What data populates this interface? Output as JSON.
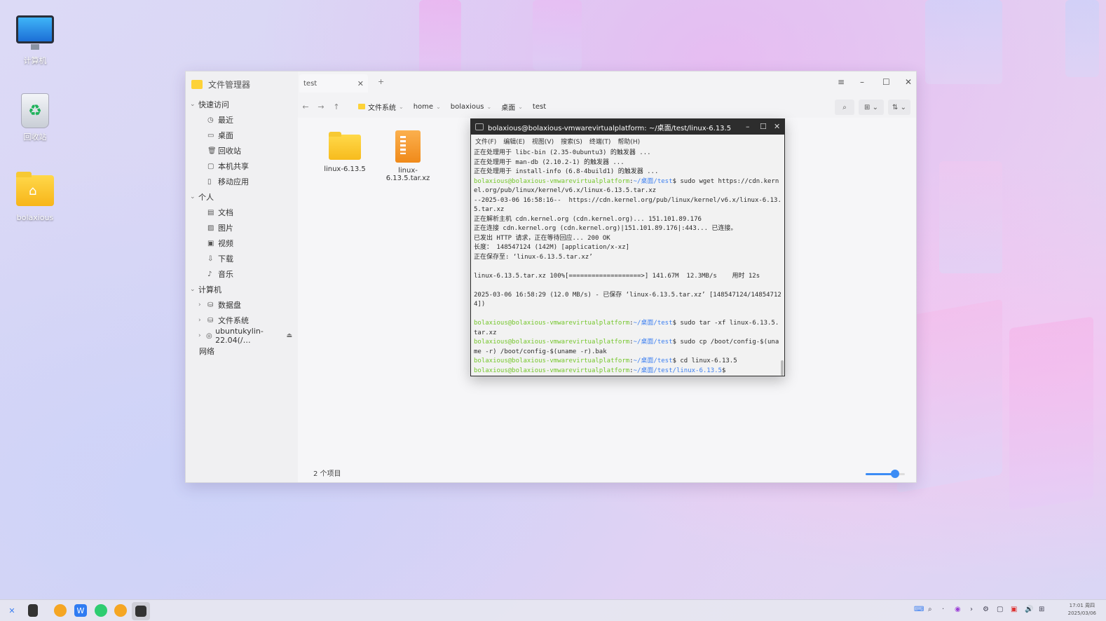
{
  "desktop": {
    "icons": [
      {
        "label": "计算机"
      },
      {
        "label": "回收站"
      },
      {
        "label": "bolaxious"
      }
    ]
  },
  "file_manager": {
    "app_title": "文件管理器",
    "tab_label": "test",
    "tab_close": "✕",
    "tab_add": "+",
    "window_controls": {
      "menu": "≡",
      "minimize": "–",
      "maximize": "☐",
      "close": "✕"
    },
    "sidebar": {
      "groups": [
        {
          "label": "快速访问",
          "items": [
            {
              "label": "最近",
              "icon": "clock-icon"
            },
            {
              "label": "桌面",
              "icon": "desktop-icon"
            },
            {
              "label": "回收站",
              "icon": "trash-icon"
            },
            {
              "label": "本机共享",
              "icon": "share-icon"
            },
            {
              "label": "移动应用",
              "icon": "phone-icon"
            }
          ]
        },
        {
          "label": "个人",
          "items": [
            {
              "label": "文档",
              "icon": "document-icon"
            },
            {
              "label": "图片",
              "icon": "image-icon"
            },
            {
              "label": "视频",
              "icon": "video-icon"
            },
            {
              "label": "下载",
              "icon": "download-icon"
            },
            {
              "label": "音乐",
              "icon": "music-icon"
            }
          ]
        },
        {
          "label": "计算机",
          "items": [
            {
              "label": "数据盘",
              "icon": "drive-icon"
            },
            {
              "label": "文件系统",
              "icon": "drive-icon"
            },
            {
              "label": "ubuntukylin-22.04(/…",
              "icon": "disc-icon"
            }
          ]
        }
      ],
      "network": "网络"
    },
    "breadcrumb": [
      "文件系统",
      "home",
      "bolaxious",
      "桌面",
      "test"
    ],
    "files": [
      {
        "name": "linux-6.13.5",
        "type": "folder"
      },
      {
        "name": "linux-6.13.5.tar.xz",
        "type": "archive"
      }
    ],
    "status": "2 个项目",
    "zoom_fraction": 0.75
  },
  "terminal": {
    "title": "bolaxious@bolaxious-vmwarevirtualplatform: ~/桌面/test/linux-6.13.5",
    "menu": [
      "文件(F)",
      "编辑(E)",
      "视图(V)",
      "搜索(S)",
      "终端(T)",
      "帮助(H)"
    ],
    "lines": [
      {
        "text": "正在处理用于 libc-bin (2.35-0ubuntu3) 的触发器 ..."
      },
      {
        "text": "正在处理用于 man-db (2.10.2-1) 的触发器 ..."
      },
      {
        "text": "正在处理用于 install-info (6.8-4build1) 的触发器 ..."
      },
      {
        "user": "bolaxious@bolaxious-vmwarevirtualplatform",
        "path": "~/桌面/test",
        "cmd": "$ sudo wget https://cdn.kernel.org/pub/linux/kernel/v6.x/linux-6.13.5.tar.xz"
      },
      {
        "text": "--2025-03-06 16:58:16--  https://cdn.kernel.org/pub/linux/kernel/v6.x/linux-6.13.5.tar.xz"
      },
      {
        "text": "正在解析主机 cdn.kernel.org (cdn.kernel.org)... 151.101.89.176"
      },
      {
        "text": "正在连接 cdn.kernel.org (cdn.kernel.org)|151.101.89.176|:443... 已连接。"
      },
      {
        "text": "已发出 HTTP 请求，正在等待回应... 200 OK"
      },
      {
        "text": "长度： 148547124 (142M) [application/x-xz]"
      },
      {
        "text": "正在保存至: ‘linux-6.13.5.tar.xz’"
      },
      {
        "text": ""
      },
      {
        "text": "linux-6.13.5.tar.xz 100%[===================>] 141.67M  12.3MB/s    用时 12s"
      },
      {
        "text": ""
      },
      {
        "text": "2025-03-06 16:58:29 (12.0 MB/s) - 已保存 ‘linux-6.13.5.tar.xz’ [148547124/148547124])"
      },
      {
        "text": ""
      },
      {
        "user": "bolaxious@bolaxious-vmwarevirtualplatform",
        "path": "~/桌面/test",
        "cmd": "$ sudo tar -xf linux-6.13.5.tar.xz"
      },
      {
        "user": "bolaxious@bolaxious-vmwarevirtualplatform",
        "path": "~/桌面/test",
        "cmd": "$ sudo cp /boot/config-$(uname -r) /boot/config-$(uname -r).bak"
      },
      {
        "user": "bolaxious@bolaxious-vmwarevirtualplatform",
        "path": "~/桌面/test",
        "cmd": "$ cd linux-6.13.5"
      },
      {
        "user": "bolaxious@bolaxious-vmwarevirtualplatform",
        "path": "~/桌面/test/linux-6.13.5",
        "cmd": "$"
      }
    ]
  },
  "taskbar": {
    "clock_time": "17:01 周四",
    "clock_date": "2025/03/06"
  },
  "colors": {
    "accent": "#3c8cf5",
    "prompt_user": "#74c62a",
    "prompt_path": "#3c7ff0"
  }
}
